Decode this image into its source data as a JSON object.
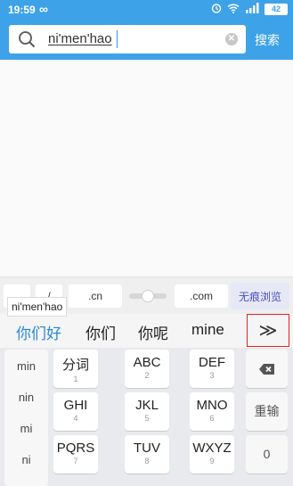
{
  "status": {
    "time": "19:59",
    "battery": "42"
  },
  "search": {
    "query": "ni'men'hao",
    "button_label": "搜索"
  },
  "quickbar": {
    "keys": [
      {
        "label": ""
      },
      {
        "label": "/"
      },
      {
        "label": ".cn"
      },
      {
        "label": ".com"
      }
    ],
    "incognito_label": "无痕浏览"
  },
  "ime": {
    "composition": "ni'men'hao",
    "candidates": [
      "你们好",
      "你们",
      "你呢",
      "mine"
    ],
    "more_label": "≫",
    "pinyin_options": [
      "min",
      "nin",
      "mi",
      "ni"
    ],
    "keys": [
      {
        "main": "分词",
        "sub": "1"
      },
      {
        "main": "ABC",
        "sub": "2"
      },
      {
        "main": "DEF",
        "sub": "3"
      },
      {
        "main": "GHI",
        "sub": "4"
      },
      {
        "main": "JKL",
        "sub": "5"
      },
      {
        "main": "MNO",
        "sub": "6"
      },
      {
        "main": "PQRS",
        "sub": "7"
      },
      {
        "main": "TUV",
        "sub": "8"
      },
      {
        "main": "WXYZ",
        "sub": "9"
      }
    ],
    "reenter_label": "重输",
    "zero_label": "0"
  }
}
